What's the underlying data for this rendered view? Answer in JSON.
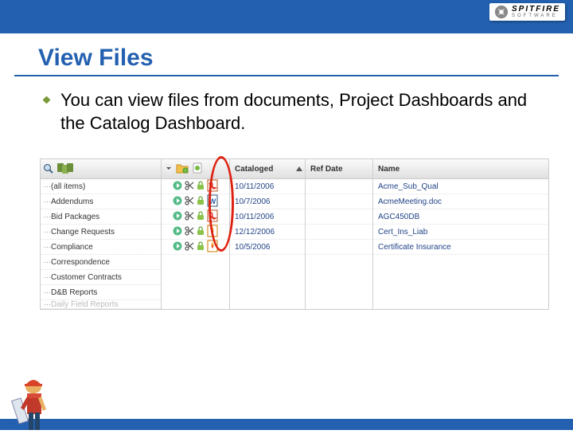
{
  "brand": {
    "name": "SPITFIRE",
    "sub": "SOFTWARE"
  },
  "title": "View Files",
  "bullet": "You can view files from documents, Project Dashboards and the Catalog Dashboard.",
  "sidebar": {
    "items": [
      "(all items)",
      "Addendums",
      "Bid Packages",
      "Change Requests",
      "Compliance",
      "Correspondence",
      "Customer Contracts",
      "D&B Reports",
      "Daily Field Reports"
    ]
  },
  "columns": {
    "cataloged": "Cataloged",
    "refdate": "Ref Date",
    "name": "Name"
  },
  "rows": [
    {
      "type": "pdf",
      "date": "10/11/2006",
      "name": "Acme_Sub_Qual"
    },
    {
      "type": "word",
      "date": "10/7/2006",
      "name": "AcmeMeeting.doc"
    },
    {
      "type": "pdf",
      "date": "10/11/2006",
      "name": "AGC450DB"
    },
    {
      "type": "fire",
      "date": "12/12/2006",
      "name": "Cert_Ins_Liab"
    },
    {
      "type": "fire",
      "date": "10/5/2006",
      "name": "Certificate Insurance"
    }
  ]
}
